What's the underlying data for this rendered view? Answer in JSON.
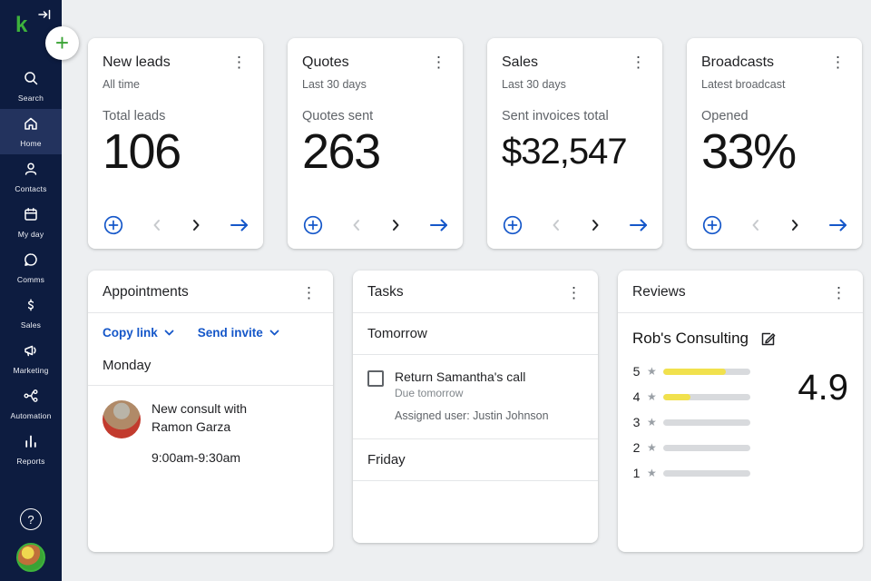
{
  "colors": {
    "accent_blue": "#1557c9",
    "brand_green": "#3aa335",
    "bar_yellow": "#f1e14d",
    "sidebar_bg": "#0d1c40"
  },
  "sidebar": {
    "logo": "k",
    "items": [
      {
        "icon": "search-icon",
        "label": "Search"
      },
      {
        "icon": "home-icon",
        "label": "Home",
        "active": true
      },
      {
        "icon": "contacts-icon",
        "label": "Contacts"
      },
      {
        "icon": "calendar-icon",
        "label": "My day"
      },
      {
        "icon": "chat-icon",
        "label": "Comms"
      },
      {
        "icon": "dollar-icon",
        "label": "Sales"
      },
      {
        "icon": "megaphone-icon",
        "label": "Marketing"
      },
      {
        "icon": "automation-icon",
        "label": "Automation"
      },
      {
        "icon": "bar-chart-icon",
        "label": "Reports"
      }
    ],
    "help_label": "?"
  },
  "stats": [
    {
      "title": "New leads",
      "subtitle": "All time",
      "metric_label": "Total leads",
      "metric_value": "106"
    },
    {
      "title": "Quotes",
      "subtitle": "Last 30 days",
      "metric_label": "Quotes sent",
      "metric_value": "263"
    },
    {
      "title": "Sales",
      "subtitle": "Last 30 days",
      "metric_label": "Sent invoices total",
      "metric_value": "$32,547"
    },
    {
      "title": "Broadcasts",
      "subtitle": "Latest broadcast",
      "metric_label": "Opened",
      "metric_value": "33%"
    }
  ],
  "appointments": {
    "title": "Appointments",
    "copy_link_label": "Copy link",
    "send_invite_label": "Send invite",
    "day_label": "Monday",
    "event": {
      "title": "New consult with Ramon Garza",
      "time": "9:00am-9:30am"
    }
  },
  "tasks": {
    "title": "Tasks",
    "section_first": "Tomorrow",
    "task": {
      "title": "Return Samantha's call",
      "due": "Due tomorrow",
      "assigned": "Assigned user: Justin Johnson"
    },
    "section_second": "Friday"
  },
  "reviews": {
    "title": "Reviews",
    "business_name": "Rob's Consulting",
    "score": "4.9",
    "bars": [
      {
        "label": "5",
        "fill": 72
      },
      {
        "label": "4",
        "fill": 32
      },
      {
        "label": "3",
        "fill": 0
      },
      {
        "label": "2",
        "fill": 0
      },
      {
        "label": "1",
        "fill": 0
      }
    ]
  }
}
